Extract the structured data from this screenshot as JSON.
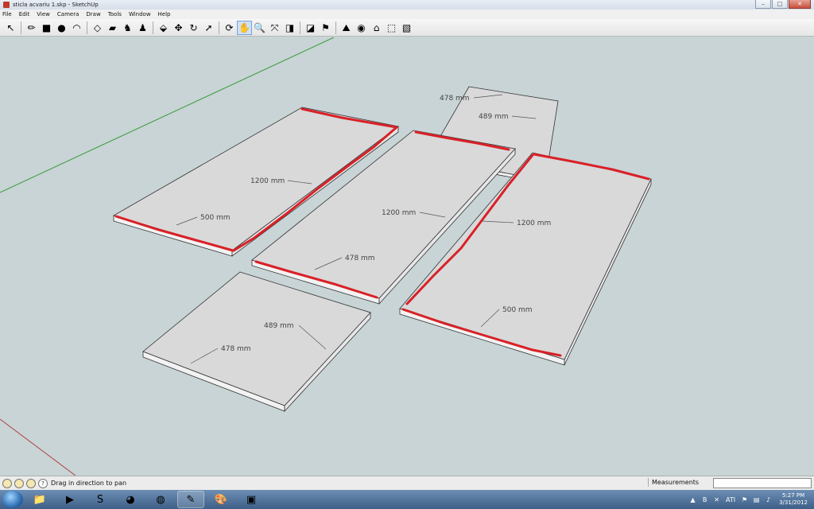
{
  "window": {
    "title": "sticla acvariu 1.skp - SketchUp",
    "controls": {
      "minimize": "–",
      "maximize": "□",
      "close": "✕"
    }
  },
  "menu": [
    "File",
    "Edit",
    "View",
    "Camera",
    "Draw",
    "Tools",
    "Window",
    "Help"
  ],
  "toolbar": {
    "tools": [
      {
        "name": "select-tool",
        "glyph": "↖"
      },
      {
        "name": "pencil-tool",
        "glyph": "✏"
      },
      {
        "name": "rectangle-tool",
        "glyph": "■"
      },
      {
        "name": "circle-tool",
        "glyph": "●"
      },
      {
        "name": "arc-tool",
        "glyph": "◠"
      },
      {
        "name": "make-component-tool",
        "glyph": "◇"
      },
      {
        "name": "eraser-tool",
        "glyph": "▰"
      },
      {
        "name": "tape-measure-tool",
        "glyph": "♞"
      },
      {
        "name": "paint-bucket-tool",
        "glyph": "♟"
      },
      {
        "name": "push-pull-tool",
        "glyph": "⬙"
      },
      {
        "name": "move-tool",
        "glyph": "✥"
      },
      {
        "name": "rotate-tool",
        "glyph": "↻"
      },
      {
        "name": "follow-me-tool",
        "glyph": "➚"
      },
      {
        "name": "orbit-tool",
        "glyph": "⟳"
      },
      {
        "name": "pan-tool",
        "glyph": "✋",
        "active": true
      },
      {
        "name": "zoom-tool",
        "glyph": "🔍"
      },
      {
        "name": "zoom-extents-tool",
        "glyph": "⤧"
      },
      {
        "name": "previous-view-tool",
        "glyph": "◨"
      },
      {
        "name": "get-models-tool",
        "glyph": "◪"
      },
      {
        "name": "add-location-tool",
        "glyph": "⚑"
      },
      {
        "name": "toggle-terrain-tool",
        "glyph": "⛰"
      },
      {
        "name": "google-earth-tool",
        "glyph": "◉"
      },
      {
        "name": "warehouse-tool",
        "glyph": "⌂"
      },
      {
        "name": "component-share-tool",
        "glyph": "⬚"
      },
      {
        "name": "extension-tool",
        "glyph": "▧"
      }
    ]
  },
  "dimensions": {
    "d1": "478 mm",
    "d2": "489 mm",
    "d3": "1200 mm",
    "d4": "500 mm",
    "d5": "1200 mm",
    "d6": "478 mm",
    "d7": "1200 mm",
    "d8": "500 mm",
    "d9": "489 mm",
    "d10": "478 mm"
  },
  "status": {
    "hint": "Drag in direction to pan",
    "help_glyph": "?",
    "measurements_label": "Measurements",
    "measurements_value": ""
  },
  "taskbar": {
    "apps": [
      {
        "name": "explorer-app",
        "glyph": "📁"
      },
      {
        "name": "media-player-app",
        "glyph": "▶"
      },
      {
        "name": "skype-app",
        "glyph": "S"
      },
      {
        "name": "winamp-app",
        "glyph": "◕"
      },
      {
        "name": "firefox-app",
        "glyph": "◍"
      },
      {
        "name": "sketchup-app",
        "glyph": "✎",
        "open": true
      },
      {
        "name": "paint-app",
        "glyph": "🎨"
      },
      {
        "name": "window-app",
        "glyph": "▣"
      }
    ],
    "tray": [
      "▲",
      "B",
      "✕",
      "ATI",
      "⚑",
      "▤",
      "♪"
    ],
    "clock_time": "5:27 PM",
    "clock_date": "3/31/2012"
  },
  "colors": {
    "viewport_bg": "#c8d4d6",
    "panel_top": "#d9d9d9",
    "panel_edge": "#f2f2f2",
    "outline": "#333333",
    "highlight_red": "#d92027",
    "axis_green": "#3a9a3a",
    "axis_red": "#b04040"
  }
}
